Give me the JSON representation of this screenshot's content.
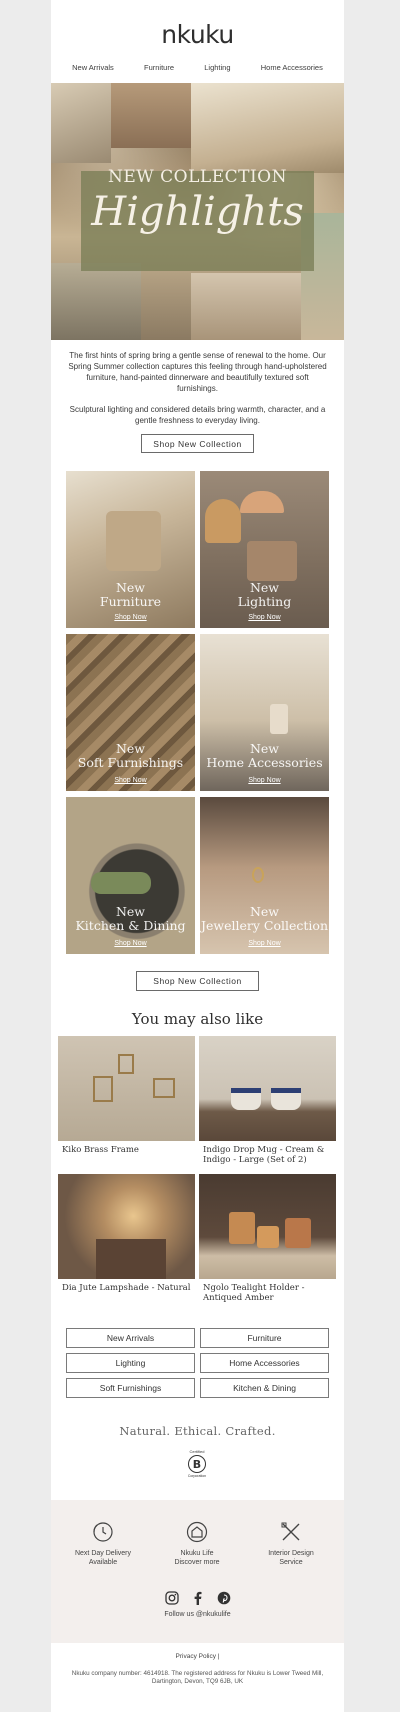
{
  "brand": {
    "logo": "nkuku"
  },
  "nav": [
    "New Arrivals",
    "Furniture",
    "Lighting",
    "Home Accessories"
  ],
  "hero": {
    "title_line1": "NEW COLLECTION",
    "title_line2": "Highlights"
  },
  "intro": {
    "p1": "The first hints of spring bring a gentle sense of renewal to the home. Our Spring Summer collection captures this feeling through hand-upholstered furniture, hand-painted dinnerware and beautifully textured soft furnishings.",
    "p2": "Sculptural lighting and considered details bring warmth, character, and a gentle freshness to everyday living."
  },
  "cta": {
    "label": "Shop New Collection"
  },
  "tiles": [
    {
      "line1": "New",
      "line2": "Furniture",
      "shop": "Shop Now"
    },
    {
      "line1": "New",
      "line2": "Lighting",
      "shop": "Shop Now"
    },
    {
      "line1": "New",
      "line2": "Soft Furnishings",
      "shop": "Shop Now"
    },
    {
      "line1": "New",
      "line2": "Home Accessories",
      "shop": "Shop Now"
    },
    {
      "line1": "New",
      "line2": "Kitchen & Dining",
      "shop": "Shop Now"
    },
    {
      "line1": "New",
      "line2": "Jewellery Collection",
      "shop": "Shop Now"
    }
  ],
  "recommend": {
    "title": "You may also like",
    "products": [
      {
        "name": "Kiko Brass Frame"
      },
      {
        "name": "Indigo Drop Mug - Cream & Indigo - Large (Set of 2)"
      },
      {
        "name": "Dia Jute Lampshade - Natural"
      },
      {
        "name": "Ngolo Tealight Holder - Antiqued Amber"
      }
    ]
  },
  "category_links": [
    "New Arrivals",
    "Furniture",
    "Lighting",
    "Home Accessories",
    "Soft Furnishings",
    "Kitchen & Dining"
  ],
  "tagline": "Natural. Ethical. Crafted.",
  "bcorp": {
    "certified": "Certified",
    "letter": "B",
    "corporation": "Corporation"
  },
  "features": [
    {
      "line1": "Next Day Delivery",
      "line2": "Available",
      "icon": "clock-icon"
    },
    {
      "line1": "Nkuku Life",
      "line2": "Discover more",
      "icon": "house-icon"
    },
    {
      "line1": "Interior Design",
      "line2": "Service",
      "icon": "design-tools-icon"
    }
  ],
  "social": {
    "follow": "Follow us @nkukulife",
    "icons": [
      "instagram-icon",
      "facebook-icon",
      "pinterest-icon"
    ]
  },
  "footer": {
    "privacy": "Privacy Policy  |",
    "legal": "Nkuku company number: 4614918. The registered address for Nkuku is Lower Tweed Mill, Dartington, Devon, TQ9 6JB, UK"
  }
}
